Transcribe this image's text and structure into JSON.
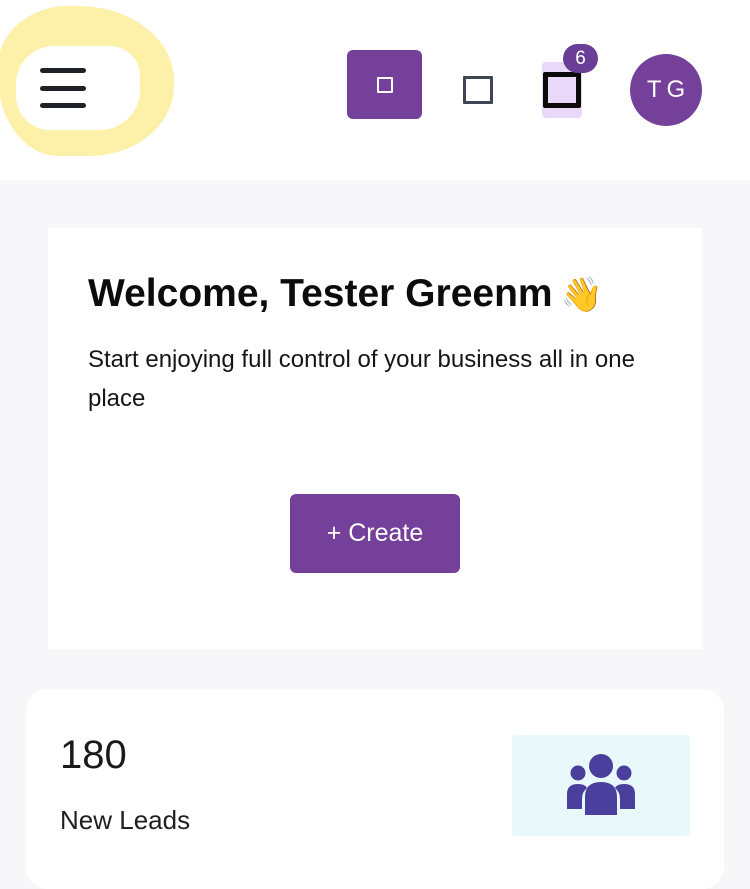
{
  "header": {
    "badge_count": "6",
    "avatar_initials": "TG",
    "icons": {
      "menu": "hamburger-menu-icon",
      "primary": "square-icon",
      "secondary": "outline-square-icon",
      "notifications": "notification-icon"
    }
  },
  "welcome": {
    "title": "Welcome, Tester Greenm",
    "emoji": "👋",
    "subtitle": "Start enjoying full control of your business all in one place",
    "create_label": "+ Create"
  },
  "stats": {
    "leads_value": "180",
    "leads_label": "New Leads",
    "leads_icon": "users-group-icon"
  },
  "colors": {
    "brand": "#74409a",
    "highlight": "#fdf0a8",
    "leads_icon": "#4a3f9c",
    "leads_icon_bg": "#e8f8fb"
  }
}
